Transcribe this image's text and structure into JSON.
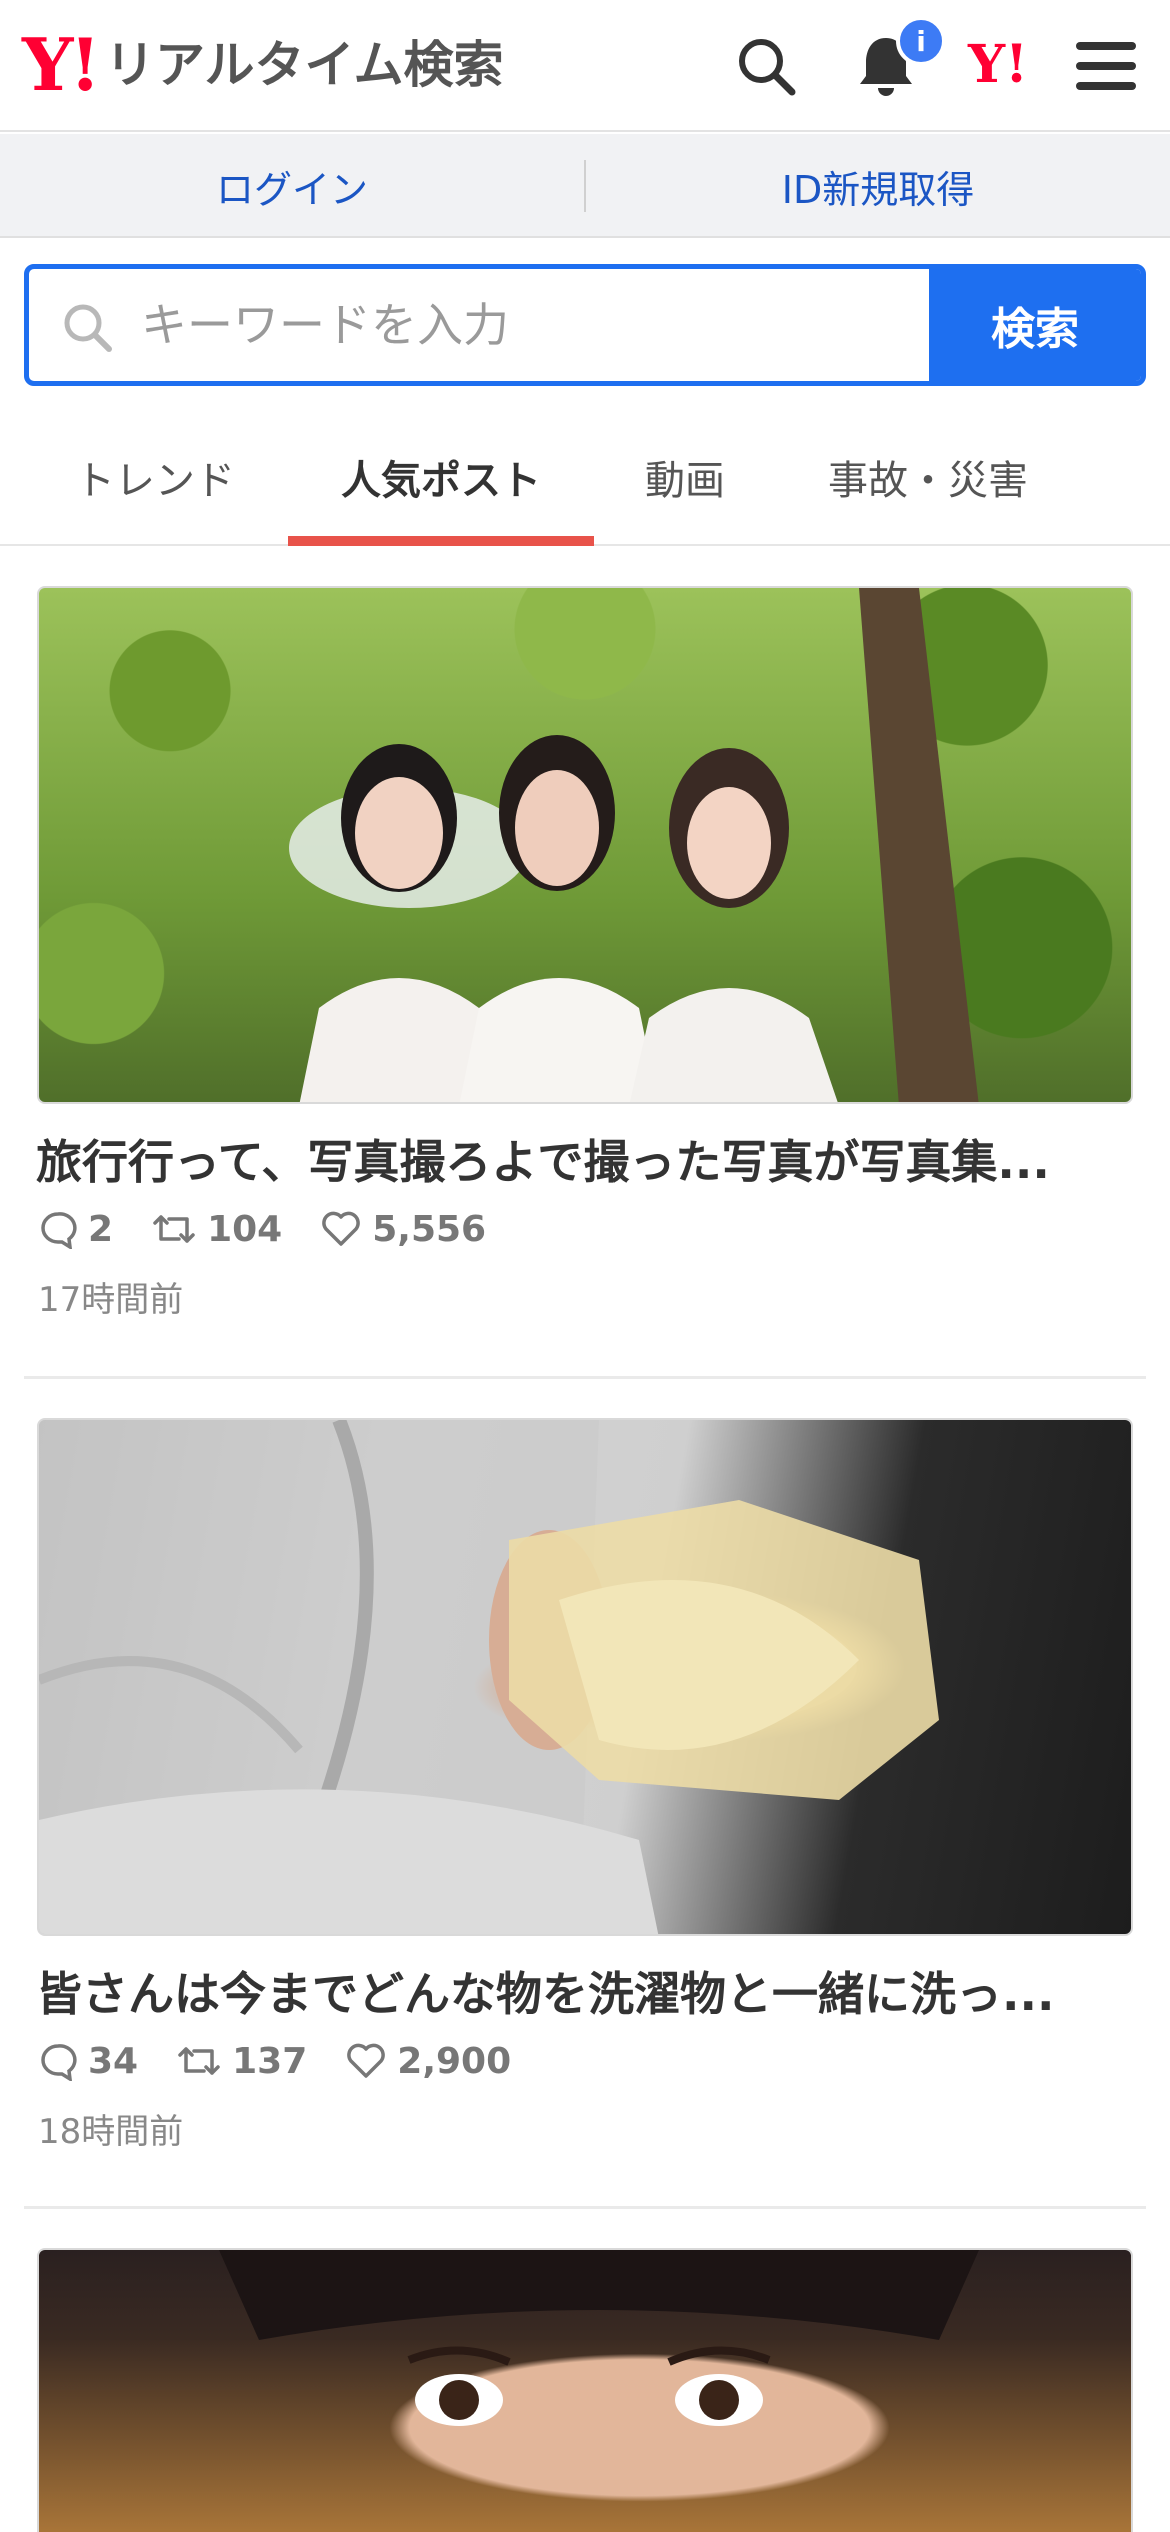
{
  "header": {
    "logo_mark": "Y!",
    "logo_text": "リアルタイム検索",
    "notification_badge": "i",
    "yahoo_mark": "Y!"
  },
  "auth": {
    "login_label": "ログイン",
    "signup_label": "ID新規取得"
  },
  "search": {
    "placeholder": "キーワードを入力",
    "button_label": "検索"
  },
  "tabs": [
    {
      "label": "トレンド",
      "active": false
    },
    {
      "label": "人気ポスト",
      "active": true
    },
    {
      "label": "動画",
      "active": false
    },
    {
      "label": "事故・災害",
      "active": false
    }
  ],
  "posts": [
    {
      "title": "旅行行って、写真撮ろよで撮った写真が写真集...",
      "replies": "2",
      "reposts": "104",
      "likes": "5,556",
      "time": "17時間前"
    },
    {
      "title": "皆さんは今までどんな物を洗濯物と一緒に洗っ...",
      "replies": "34",
      "reposts": "137",
      "likes": "2,900",
      "time": "18時間前"
    }
  ],
  "colors": {
    "brand_red": "#ff0033",
    "accent_blue": "#1e6ff0",
    "tab_underline": "#e8534a",
    "link_blue": "#1b56c4"
  },
  "icons": [
    "search-icon",
    "bell-icon",
    "menu-icon",
    "reply-icon",
    "repost-icon",
    "heart-icon"
  ]
}
